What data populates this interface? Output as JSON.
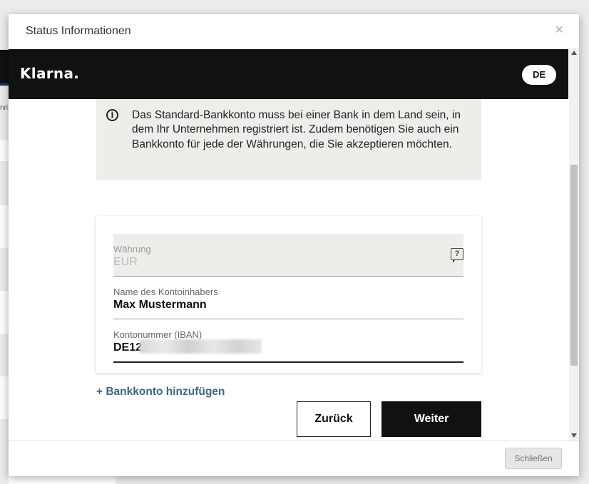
{
  "background": {
    "partial_text": "nrif"
  },
  "modal": {
    "title": "Status Informationen",
    "close_symbol": "×",
    "footer_close_label": "Schließen"
  },
  "klarna": {
    "logo_text": "Klarna.",
    "language_button": "DE"
  },
  "info": {
    "icon": "info-icon",
    "text": "Das Standard-Bankkonto muss bei einer Bank in dem Land sein, in dem Ihr Unternehmen registriert ist. Zudem benötigen Sie auch ein Bankkonto für jede der Währungen, die Sie akzeptieren möchten."
  },
  "form": {
    "currency": {
      "label": "Währung",
      "value": "EUR",
      "help_icon": "help-question-icon"
    },
    "account_holder": {
      "label": "Name des Kontoinhabers",
      "value": "Max Mustermann"
    },
    "iban": {
      "label": "Kontonummer (IBAN)",
      "value": "DE12"
    }
  },
  "actions": {
    "add_account": "+ Bankkonto hinzufügen",
    "back": "Zurück",
    "next": "Weiter"
  },
  "colors": {
    "klarna_bar": "#111111",
    "info_bg": "#eeede9",
    "link": "#3d6684"
  }
}
